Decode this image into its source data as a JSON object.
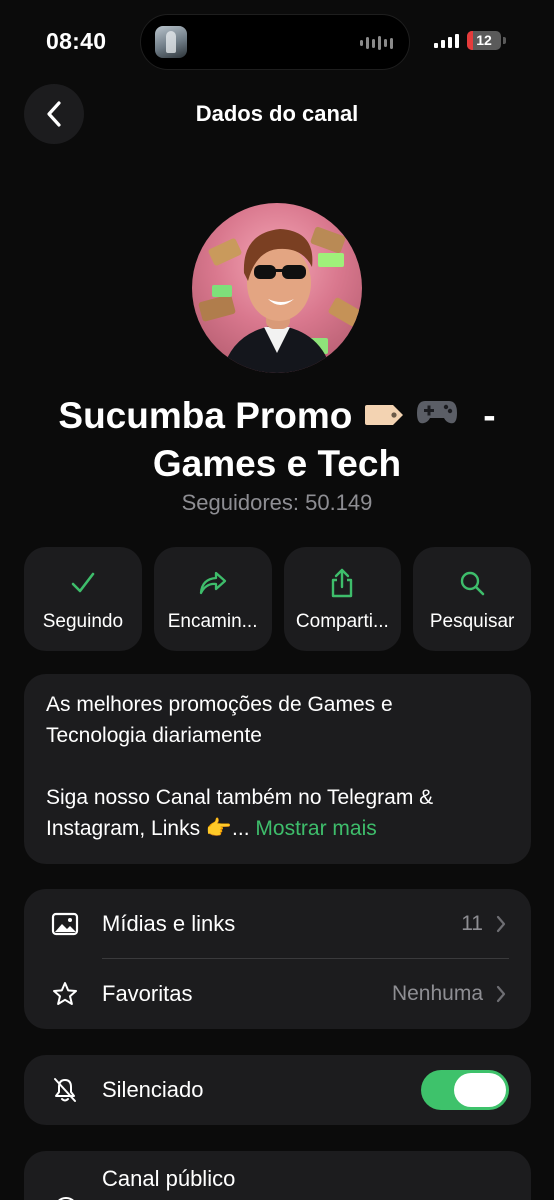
{
  "status_bar": {
    "time": "08:40",
    "battery_level": "12"
  },
  "nav": {
    "title": "Dados do canal",
    "back_icon": "chevron-left-icon"
  },
  "channel": {
    "name_line1": "Sucumba Promo",
    "name_emojis": "🏷️🎮",
    "name_dash": "-",
    "name_line2": "Games e Tech",
    "followers": "Seguidores: 50.149"
  },
  "actions": [
    {
      "label": "Seguindo",
      "icon": "checkmark-icon"
    },
    {
      "label": "Encamin...",
      "icon": "forward-arrow-icon"
    },
    {
      "label": "Comparti...",
      "icon": "share-icon"
    },
    {
      "label": "Pesquisar",
      "icon": "search-icon"
    }
  ],
  "description": {
    "line1": "As melhores promoções de Games e",
    "line2": "Tecnologia diariamente",
    "line3": "Siga nosso Canal também no Telegram &",
    "line4": "Instagram, Links 👉...",
    "more": "Mostrar mais"
  },
  "media": {
    "label": "Mídias e links",
    "count": "11",
    "icon": "image-icon"
  },
  "favorites": {
    "label": "Favoritas",
    "value": "Nenhuma",
    "icon": "star-icon"
  },
  "mute": {
    "label": "Silenciado",
    "enabled": true,
    "icon": "bell-slash-icon"
  },
  "public_channel": {
    "label": "Canal público"
  },
  "colors": {
    "accent_green": "#3ebd6b",
    "card_bg": "#1c1c1e",
    "secondary_text": "#8e8e93"
  }
}
